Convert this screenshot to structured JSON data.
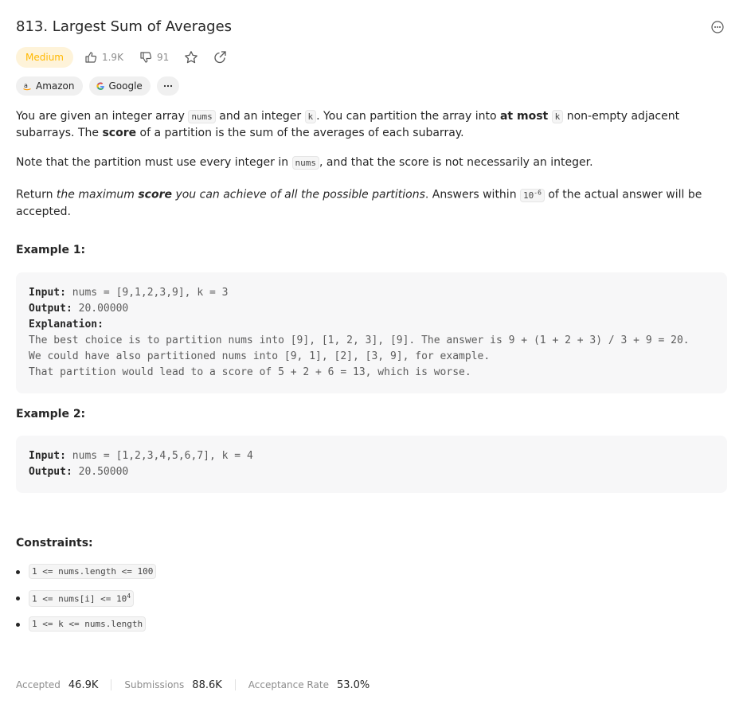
{
  "problem": {
    "title": "813. Largest Sum of Averages",
    "difficulty": "Medium",
    "likes": "1.9K",
    "dislikes": "91"
  },
  "tags": [
    {
      "label": "Amazon",
      "icon": "amazon-icon"
    },
    {
      "label": "Google",
      "icon": "google-icon"
    }
  ],
  "description": {
    "p1_a": "You are given an integer array ",
    "p1_code1": "nums",
    "p1_b": " and an integer ",
    "p1_code2": "k",
    "p1_c": ". You can partition the array into ",
    "p1_bold": "at most",
    "p1_code3": "k",
    "p1_d": " non-empty adjacent subarrays. The ",
    "p1_score": "score",
    "p1_e": " of a partition is the sum of the averages of each subarray.",
    "p2_a": "Note that the partition must use every integer in ",
    "p2_code": "nums",
    "p2_b": ", and that the score is not necessarily an integer.",
    "p3_a": "Return ",
    "p3_em1": "the maximum ",
    "p3_score": "score",
    "p3_em2": " you can achieve of all the possible partitions",
    "p3_b": ". Answers within ",
    "p3_code": "10",
    "p3_sup": "-6",
    "p3_c": " of the actual answer will be accepted."
  },
  "examples": [
    {
      "heading": "Example 1:",
      "input_label": "Input:",
      "input": " nums = [9,1,2,3,9], k = 3",
      "output_label": "Output:",
      "output": " 20.00000",
      "explanation_label": "Explanation:",
      "explanation": "The best choice is to partition nums into [9], [1, 2, 3], [9]. The answer is 9 + (1 + 2 + 3) / 3 + 9 = 20.\nWe could have also partitioned nums into [9, 1], [2], [3, 9], for example.\nThat partition would lead to a score of 5 + 2 + 6 = 13, which is worse."
    },
    {
      "heading": "Example 2:",
      "input_label": "Input:",
      "input": " nums = [1,2,3,4,5,6,7], k = 4",
      "output_label": "Output:",
      "output": " 20.50000"
    }
  ],
  "constraints": {
    "heading": "Constraints:",
    "items": [
      {
        "text": "1 <= nums.length <= 100",
        "sup": ""
      },
      {
        "text": "1 <= nums[i] <= 10",
        "sup": "4"
      },
      {
        "text": "1 <= k <= nums.length",
        "sup": ""
      }
    ]
  },
  "footer": {
    "accepted_label": "Accepted",
    "accepted_value": "46.9K",
    "submissions_label": "Submissions",
    "submissions_value": "88.6K",
    "rate_label": "Acceptance Rate",
    "rate_value": "53.0%"
  },
  "colors": {
    "medium_text": "#ffb800",
    "medium_bg": "#fef3d9",
    "amazon_orange": "#ff9900"
  }
}
